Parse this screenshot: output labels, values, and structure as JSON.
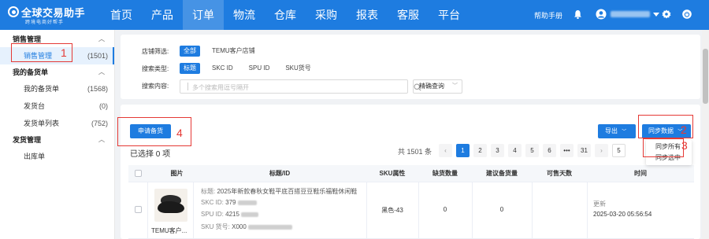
{
  "nav": {
    "logo_title": "全球交易助手",
    "logo_subtitle": "跨境电商好帮手",
    "menu": [
      "首页",
      "产品",
      "订单",
      "物流",
      "仓库",
      "采购",
      "报表",
      "客服",
      "平台"
    ],
    "active_index": 2,
    "help_label": "帮助手册",
    "icons": [
      "bell-icon",
      "user-icon",
      "gear-icon",
      "power-icon"
    ],
    "accent_color": "#1e7ce0"
  },
  "sidebar": {
    "groups": [
      {
        "label": "销售管理",
        "items": [
          {
            "label": "销售管理",
            "count": "(1501)",
            "active": true
          }
        ]
      },
      {
        "label": "我的备货单",
        "items": [
          {
            "label": "我的备货单",
            "count": "(1568)"
          },
          {
            "label": "发货台",
            "count": "(0)"
          },
          {
            "label": "发货单列表",
            "count": "(752)"
          }
        ]
      },
      {
        "label": "发货管理",
        "items": [
          {
            "label": "出库单",
            "count": ""
          }
        ]
      }
    ]
  },
  "filter": {
    "shop_label": "店铺筛选:",
    "shop_options": [
      "全部",
      "TEMU客户店铺"
    ],
    "type_label": "搜索类型:",
    "type_options": [
      "标题",
      "SKC ID",
      "SPU ID",
      "SKU货号"
    ],
    "content_label": "搜索内容:",
    "search_placeholder": "多个搜索用逗号隔开",
    "mode_label": "精确查询"
  },
  "toolbar": {
    "apply_button": "申请备货",
    "export_button": "导出",
    "sync_button": "同步数据",
    "selected_text": "已选择 0 项",
    "total_text": "共 1501 条",
    "pages": [
      "1",
      "2",
      "3",
      "4",
      "5",
      "6",
      "•••",
      "31"
    ],
    "current_page": "1",
    "page_size_partial": "5",
    "sync_menu": [
      "同步所有",
      "同步选中"
    ]
  },
  "table": {
    "headers": [
      "图片",
      "标题/ID",
      "SKU属性",
      "缺货数量",
      "建议备货量",
      "可售天数",
      "时间"
    ],
    "rows": [
      {
        "shop": "TEMU客户...",
        "title_key": "标题:",
        "title": "2025年新款春秋女鞋平底百搭豆豆鞋乐福鞋休闲鞋",
        "skc_key": "SKC ID:",
        "skc_value": "379",
        "spu_key": "SPU ID:",
        "spu_value": "4215",
        "sku_key": "SKU 货号:",
        "sku_value": "X000",
        "sku_attr": "黑色-43",
        "shortage": "0",
        "suggest": "0",
        "sellable_days": "",
        "time_label": "更新",
        "time_value": "2025-03-20 05:56:54"
      }
    ]
  },
  "annotations": [
    "1",
    "2",
    "3",
    "4"
  ]
}
